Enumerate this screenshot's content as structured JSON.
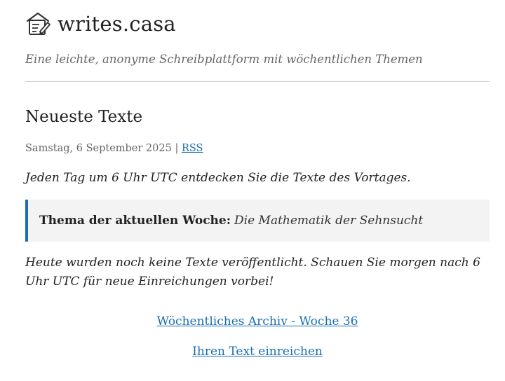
{
  "site": {
    "title": "writes.casa",
    "logo_icon": "pencil-note-icon",
    "tagline": "Eine leichte, anonyme Schreibplattform mit wöchentlichen Themen"
  },
  "main": {
    "heading": "Neueste Texte",
    "date": "Samstag, 6 September 2025",
    "separator": " | ",
    "rss_label": "RSS",
    "intro": "Jeden Tag um 6 Uhr UTC entdecken Sie die Texte des Vortages.",
    "theme": {
      "label": "Thema der aktuellen Woche:",
      "value": "Die Mathematik der Sehnsucht"
    },
    "empty_message": "Heute wurden noch keine Texte veröffentlicht. Schauen Sie morgen nach 6 Uhr UTC für neue Einreichungen vorbei!",
    "archive_link": "Wöchentliches Archiv - Woche 36",
    "submit_link": "Ihren Text einreichen"
  },
  "colors": {
    "accent": "#1a6fb0",
    "text": "#222222",
    "muted": "#666666",
    "box_bg": "#f3f3f3"
  }
}
